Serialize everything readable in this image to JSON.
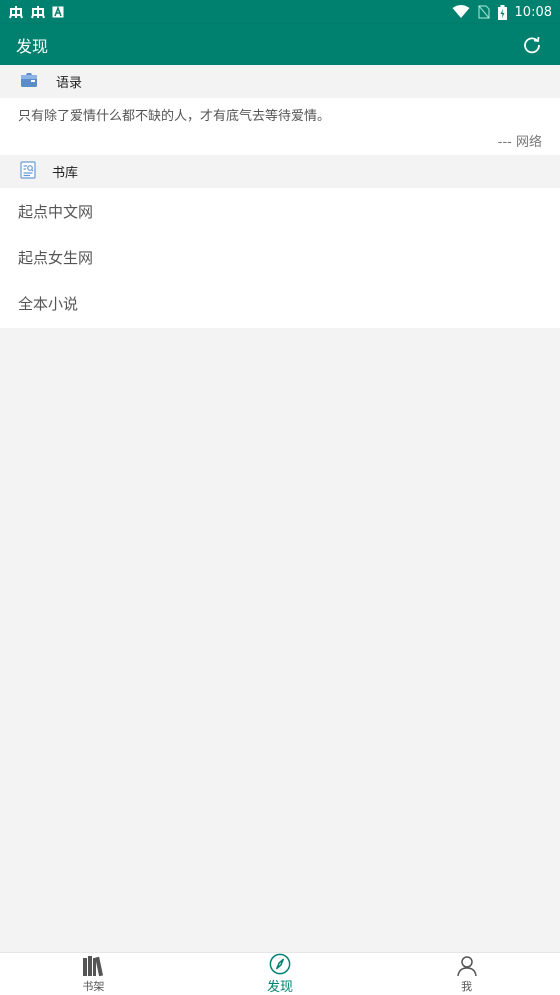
{
  "colors": {
    "primary": "#00806f",
    "background": "#f3f3f3"
  },
  "status_bar": {
    "icons": [
      "android-debug-icon",
      "android-debug-icon",
      "a-notification-icon",
      "wifi-icon",
      "no-sim-icon",
      "battery-charging-icon"
    ],
    "time": "10:08"
  },
  "app_bar": {
    "title": "发现",
    "action_icon": "refresh-icon"
  },
  "quotes_section": {
    "title": "语录",
    "icon": "quote-card-icon",
    "quote": "只有除了爱情什么都不缺的人，才有底气去等待爱情。",
    "source": "--- 网络"
  },
  "library_section": {
    "title": "书库",
    "icon": "book-search-icon",
    "items": [
      {
        "label": "起点中文网"
      },
      {
        "label": "起点女生网"
      },
      {
        "label": "全本小说"
      }
    ]
  },
  "bottom_nav": {
    "items": [
      {
        "label": "书架",
        "icon": "bookshelf-icon",
        "active": false
      },
      {
        "label": "发现",
        "icon": "compass-icon",
        "active": true
      },
      {
        "label": "我",
        "icon": "person-icon",
        "active": false
      }
    ]
  }
}
